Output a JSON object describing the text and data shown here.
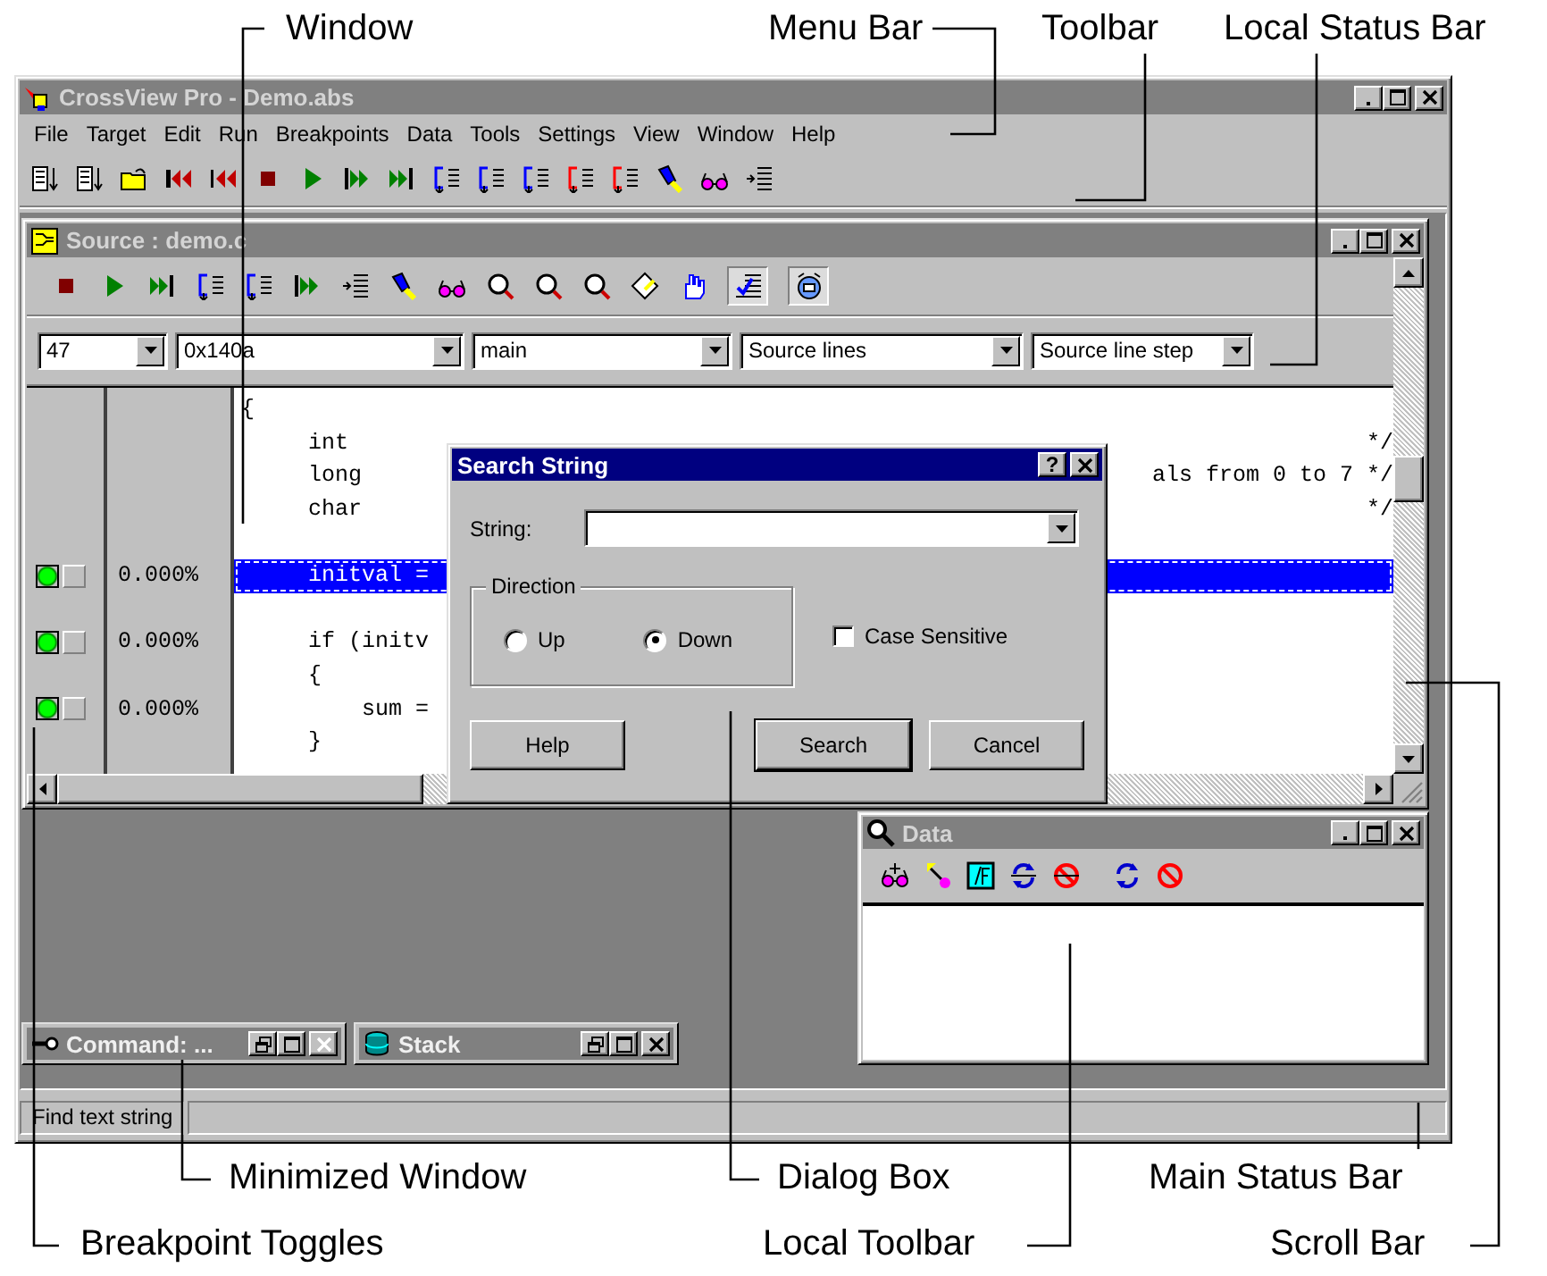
{
  "callouts": [
    "Window",
    "Menu Bar",
    "Toolbar",
    "Local Status Bar",
    "Minimized Window",
    "Dialog Box",
    "Main Status Bar",
    "Breakpoint Toggles",
    "Local Toolbar",
    "Scroll Bar"
  ],
  "window": {
    "title": "CrossView Pro - Demo.abs",
    "active": false
  },
  "menu": [
    "File",
    "Target",
    "Edit",
    "Run",
    "Breakpoints",
    "Data",
    "Tools",
    "Settings",
    "View",
    "Window",
    "Help"
  ],
  "source_window": {
    "title": "Source : demo.c",
    "active": false,
    "toolbar_toggles": [
      {
        "pressed": true
      },
      {
        "pressed": true
      }
    ],
    "combos": [
      "47",
      "0x140a",
      "main",
      "Source lines",
      "Source line step"
    ],
    "lines": [
      {
        "text": "{",
        "selected": false
      },
      {
        "text": "     int",
        "right": "*/",
        "selected": false
      },
      {
        "text": "     long",
        "right": "als from 0 to 7 */",
        "selected": false
      },
      {
        "text": "     char",
        "right": "*/",
        "selected": false
      },
      {
        "selected": false
      },
      {
        "text": "     initval =",
        "selected": true,
        "percent": "0.000%",
        "bp_on": true,
        "bp_mark": false
      },
      {
        "selected": false
      },
      {
        "text": "     if (initv",
        "selected": false,
        "percent": "0.000%",
        "bp_on": true,
        "bp_mark": false
      },
      {
        "text": "     {",
        "selected": false
      },
      {
        "text": "         sum =",
        "selected": false,
        "percent": "0.000%",
        "bp_on": true,
        "bp_mark": false
      },
      {
        "text": "     }",
        "selected": false
      }
    ]
  },
  "dialog": {
    "title": "Search String",
    "active": true,
    "help_glyph": "?",
    "string_label": "String:",
    "direction_label": "Direction",
    "directions": [
      {
        "label": "Up",
        "selected": false
      },
      {
        "label": "Down",
        "selected": true
      }
    ],
    "case_sensitive": {
      "label": "Case Sensitive",
      "checked": false
    },
    "buttons": [
      {
        "label": "Help",
        "default": false
      },
      {
        "label": "Search",
        "default": true
      },
      {
        "label": "Cancel",
        "default": false
      }
    ]
  },
  "data_window": {
    "title": "Data",
    "active": false
  },
  "minimized": [
    {
      "title": "Command: ...",
      "close_disabled": true
    },
    {
      "title": "Stack",
      "close_disabled": false
    }
  ],
  "status_bar": {
    "text": "Find text string"
  }
}
